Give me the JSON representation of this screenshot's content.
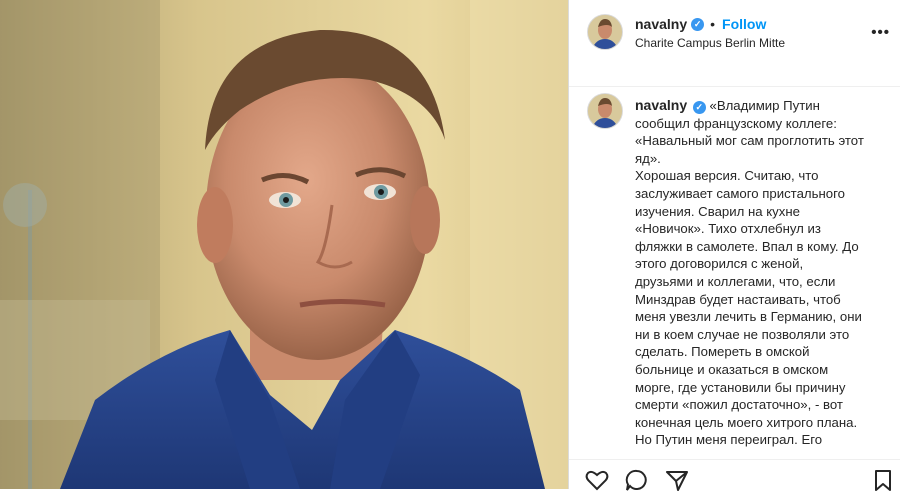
{
  "post": {
    "username": "navalny",
    "follow_label": "Follow",
    "location": "Charite Campus Berlin Mitte",
    "more_label": "•••",
    "verified_glyph": "✓",
    "caption_lines": [
      "«Владимир Путин",
      "сообщил французскому коллеге:",
      "«Навальный мог сам проглотить этот",
      "яд».",
      "Хорошая версия. Считаю, что",
      "заслуживает самого пристального",
      "изучения. Сварил на кухне",
      "«Новичок». Тихо отхлебнул из",
      "фляжки в самолете. Впал в кому. До",
      "этого договорился с женой,",
      "друзьями и коллегами, что, если",
      "Минздрав будет настаивать, чтоб",
      "меня увезли лечить в Германию, они",
      "ни в коем случае не позволяли это",
      "сделать. Помереть в омской",
      "больнице и оказаться в омском",
      "морге, где установили бы причину",
      "смерти «пожил достаточно», - вот",
      "конечная цель моего хитрого плана.",
      "Но Путин меня переиграл. Его"
    ]
  },
  "actions": {
    "icons": [
      "heart-icon",
      "comment-icon",
      "share-icon",
      "bookmark-icon"
    ]
  },
  "colors": {
    "accent": "#0095f6",
    "verified": "#3897f0",
    "text": "#262626",
    "shirt": "#26438a"
  }
}
